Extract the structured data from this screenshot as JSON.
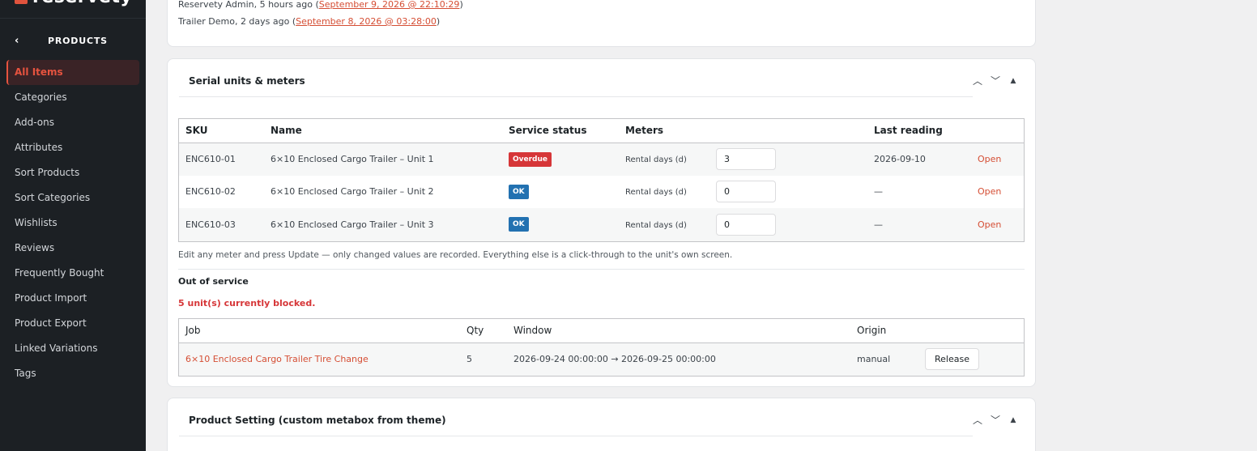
{
  "brand": {
    "name": "reservety"
  },
  "sidebar": {
    "section_title": "PRODUCTS",
    "items": [
      {
        "label": "All Items"
      },
      {
        "label": "Categories"
      },
      {
        "label": "Add-ons"
      },
      {
        "label": "Attributes"
      },
      {
        "label": "Sort Products"
      },
      {
        "label": "Sort Categories"
      },
      {
        "label": "Wishlists"
      },
      {
        "label": "Reviews"
      },
      {
        "label": "Frequently Bought"
      },
      {
        "label": "Product Import"
      },
      {
        "label": "Product Export"
      },
      {
        "label": "Linked Variations"
      },
      {
        "label": "Tags"
      }
    ]
  },
  "revisions": [
    {
      "prefix": "Reservety Admin, 5 hours ago (",
      "date": "September 9, 2026 @ 22:10:29",
      "suffix": ")"
    },
    {
      "prefix": "Trailer Demo, 2 days ago (",
      "date": "September 8, 2026 @ 03:28:00",
      "suffix": ")"
    }
  ],
  "serial_card": {
    "title": "Serial units & meters",
    "columns": {
      "sku": "SKU",
      "name": "Name",
      "status": "Service status",
      "meters": "Meters",
      "last": "Last reading"
    },
    "rows": [
      {
        "sku": "ENC610-01",
        "name": "6×10 Enclosed Cargo Trailer – Unit 1",
        "status": "Overdue",
        "meter_label": "Rental days (d)",
        "meter_value": "3",
        "last": "2026-09-10",
        "action": "Open"
      },
      {
        "sku": "ENC610-02",
        "name": "6×10 Enclosed Cargo Trailer – Unit 2",
        "status": "OK",
        "meter_label": "Rental days (d)",
        "meter_value": "0",
        "last": "—",
        "action": "Open"
      },
      {
        "sku": "ENC610-03",
        "name": "6×10 Enclosed Cargo Trailer – Unit 3",
        "status": "OK",
        "meter_label": "Rental days (d)",
        "meter_value": "0",
        "last": "—",
        "action": "Open"
      }
    ],
    "help_text": "Edit any meter and press Update — only changed values are recorded. Everything else is a click-through to the unit's own screen.",
    "oos_title": "Out of service",
    "oos_warning": "5 unit(s) currently blocked.",
    "jobs_columns": {
      "job": "Job",
      "qty": "Qty",
      "window": "Window",
      "origin": "Origin"
    },
    "jobs": [
      {
        "job": "6×10 Enclosed Cargo Trailer Tire Change",
        "qty": "5",
        "window": "2026-09-24 00:00:00 → 2026-09-25 00:00:00",
        "origin": "manual",
        "action": "Release"
      }
    ]
  },
  "setting_card": {
    "title": "Product Setting (custom metabox from theme)"
  },
  "colors": {
    "accent": "#e6533f",
    "overdue": "#d63638",
    "ok": "#2271b1",
    "sidebar_bg": "#1c2024"
  }
}
